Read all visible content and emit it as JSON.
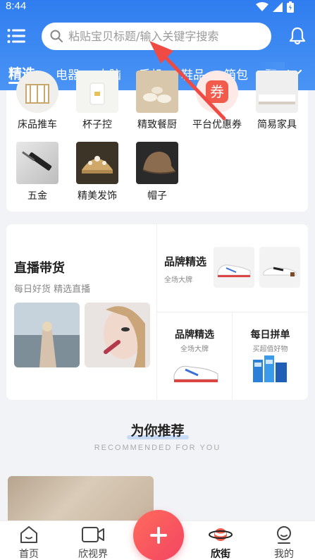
{
  "status": {
    "time": "8:44"
  },
  "search": {
    "placeholder": "粘贴宝贝标题/输入关键字搜索"
  },
  "tabs": [
    {
      "label": "精选"
    },
    {
      "label": "电器"
    },
    {
      "label": "电脑"
    },
    {
      "label": "手机"
    },
    {
      "label": "鞋品"
    },
    {
      "label": "箱包"
    },
    {
      "label": "配"
    }
  ],
  "categories": [
    {
      "label": "床品推车"
    },
    {
      "label": "杯子控"
    },
    {
      "label": "精致餐厨"
    },
    {
      "label": "平台优惠券",
      "badge": "券"
    },
    {
      "label": "简易家具"
    },
    {
      "label": "五金"
    },
    {
      "label": "精美发饰"
    },
    {
      "label": "帽子"
    }
  ],
  "promo": {
    "live_title": "直播带货",
    "live_sub": "每日好货 精选直播",
    "brand1_title": "品牌精选",
    "brand1_sub": "全场大牌",
    "brand2_title": "品牌精选",
    "brand2_sub": "全场大牌",
    "pin_title": "每日拼单",
    "pin_sub": "买超值好物"
  },
  "recommend": {
    "title": "为你推荐",
    "subtitle": "RECOMMENDED FOR YOU"
  },
  "bottom_nav": [
    {
      "label": "首页",
      "icon": "home-icon"
    },
    {
      "label": "欣视界",
      "icon": "video-icon"
    },
    {
      "label": "",
      "icon": "plus-icon"
    },
    {
      "label": "欣街",
      "icon": "planet-icon",
      "active": true
    },
    {
      "label": "我的",
      "icon": "profile-icon"
    }
  ],
  "colors": {
    "primary": "#2f7df0",
    "fab": "#f24562",
    "arrow": "#f04a45"
  }
}
